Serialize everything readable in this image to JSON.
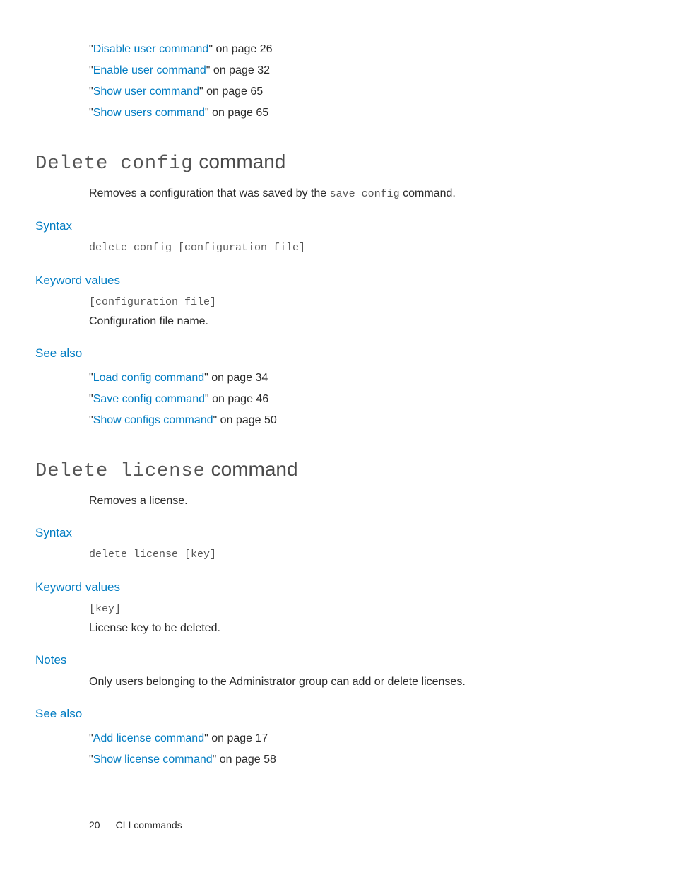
{
  "topRefs": [
    {
      "link": "Disable user command",
      "suffix": "\" on page 26"
    },
    {
      "link": "Enable user command",
      "suffix": "\" on page 32"
    },
    {
      "link": "Show user command",
      "suffix": "\" on page 65"
    },
    {
      "link": "Show users command",
      "suffix": "\" on page 65"
    }
  ],
  "sec1": {
    "headMono": "Delete config",
    "headWord": " command",
    "descPre": "Removes a configuration that was saved by the ",
    "descMono": "save config",
    "descPost": " command.",
    "syntaxLabel": "Syntax",
    "syntaxCode": "delete config [configuration file]",
    "kwLabel": "Keyword values",
    "kwCode": "[configuration file]",
    "kwDesc": "Configuration file name.",
    "seeAlsoLabel": "See also",
    "seeAlso": [
      {
        "link": "Load config command",
        "suffix": "\" on page 34"
      },
      {
        "link": "Save config command",
        "suffix": "\" on page 46"
      },
      {
        "link": "Show configs command",
        "suffix": "\" on page 50"
      }
    ]
  },
  "sec2": {
    "headMono": "Delete license",
    "headWord": " command",
    "desc": "Removes a license.",
    "syntaxLabel": "Syntax",
    "syntaxCode": "delete license [key]",
    "kwLabel": "Keyword values",
    "kwCode": "[key]",
    "kwDesc": "License key to be deleted.",
    "notesLabel": "Notes",
    "notesBody": "Only users belonging to the Administrator group can add or delete licenses.",
    "seeAlsoLabel": "See also",
    "seeAlso": [
      {
        "link": "Add license command",
        "suffix": "\" on page 17"
      },
      {
        "link": "Show license command",
        "suffix": "\" on page 58"
      }
    ]
  },
  "footer": {
    "pageNum": "20",
    "section": "CLI commands"
  }
}
